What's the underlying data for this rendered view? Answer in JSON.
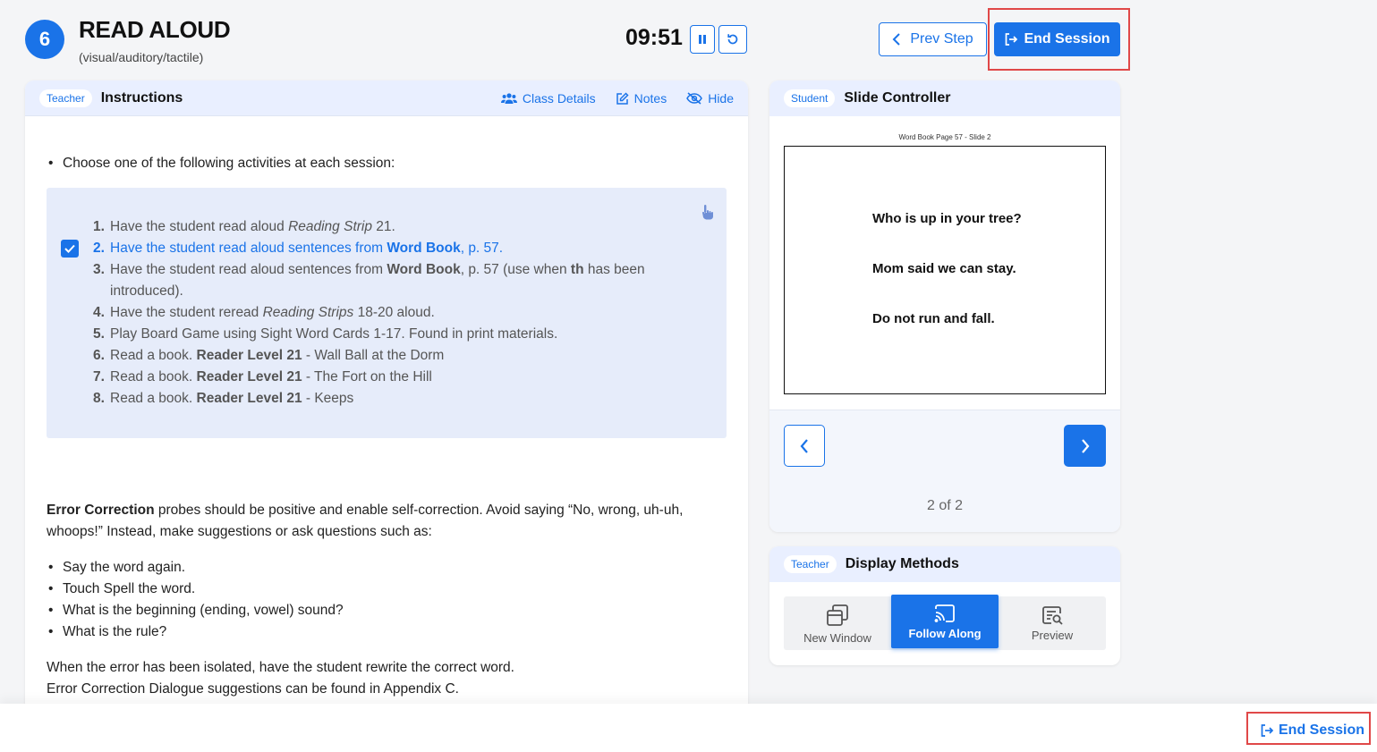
{
  "header": {
    "step_number": "6",
    "title": "READ ALOUD",
    "subtitle": "(visual/auditory/tactile)",
    "timer": "09:51",
    "prev_label": "Prev Step",
    "end_label": "End Session"
  },
  "instructions": {
    "role": "Teacher",
    "title": "Instructions",
    "actions": {
      "class_details": "Class Details",
      "notes": "Notes",
      "hide": "Hide"
    },
    "intro": "Choose one of the following activities at each session:",
    "activities": [
      {
        "num": "1.",
        "parts": [
          {
            "t": "Have the student read aloud "
          },
          {
            "t": "Reading Strip",
            "s": "i"
          },
          {
            "t": " 21."
          }
        ]
      },
      {
        "num": "2.",
        "selected": true,
        "parts": [
          {
            "t": "Have the student read aloud sentences from "
          },
          {
            "t": "Word Book",
            "s": "b"
          },
          {
            "t": ", p. 57."
          }
        ]
      },
      {
        "num": "3.",
        "parts": [
          {
            "t": "Have the student read aloud sentences from "
          },
          {
            "t": "Word Book",
            "s": "b"
          },
          {
            "t": ", p. 57 (use when "
          },
          {
            "t": "th",
            "s": "b"
          },
          {
            "t": " has been introduced)."
          }
        ]
      },
      {
        "num": "4.",
        "parts": [
          {
            "t": "Have the student reread "
          },
          {
            "t": "Reading Strips",
            "s": "i"
          },
          {
            "t": " 18-20 aloud."
          }
        ]
      },
      {
        "num": "5.",
        "parts": [
          {
            "t": "Play Board Game using Sight Word Cards 1-17. Found in print materials."
          }
        ]
      },
      {
        "num": "6.",
        "parts": [
          {
            "t": "Read a book. "
          },
          {
            "t": "Reader Level 21",
            "s": "b"
          },
          {
            "t": " - Wall Ball at the Dorm"
          }
        ]
      },
      {
        "num": "7.",
        "parts": [
          {
            "t": "Read a book. "
          },
          {
            "t": "Reader Level 21",
            "s": "b"
          },
          {
            "t": " - The Fort on the Hill"
          }
        ]
      },
      {
        "num": "8.",
        "parts": [
          {
            "t": "Read a book. "
          },
          {
            "t": "Reader Level 21",
            "s": "b"
          },
          {
            "t": " - Keeps"
          }
        ]
      }
    ],
    "error_heading": "Error Correction",
    "error_text": " probes should be positive and enable self-correction. Avoid saying “No, wrong, uh-uh, whoops!” Instead, make suggestions or ask questions such as:",
    "error_bullets": [
      "Say the word again.",
      "Touch Spell the word.",
      "What is the beginning (ending, vowel) sound?",
      "What is the rule?"
    ],
    "closing_1": "When the error has been isolated, have the student rewrite the correct word.",
    "closing_2": "Error Correction Dialogue suggestions can be found in Appendix C."
  },
  "slide_controller": {
    "role": "Student",
    "title": "Slide Controller",
    "caption": "Word Book Page 57 - Slide 2",
    "lines": [
      "Who is up in your tree?",
      "Mom said we can stay.",
      "Do not run and fall."
    ],
    "page_indicator": "2 of 2"
  },
  "display_methods": {
    "role": "Teacher",
    "title": "Display Methods",
    "options": [
      {
        "label": "New Window",
        "icon": "new-window-icon",
        "active": false
      },
      {
        "label": "Follow Along",
        "icon": "cast-icon",
        "active": true
      },
      {
        "label": "Preview",
        "icon": "preview-icon",
        "active": false
      }
    ]
  },
  "footer": {
    "end_label": "End Session"
  },
  "colors": {
    "accent": "#1a73e8",
    "header_tint": "#e9efff",
    "highlight_box": "#e04848"
  }
}
